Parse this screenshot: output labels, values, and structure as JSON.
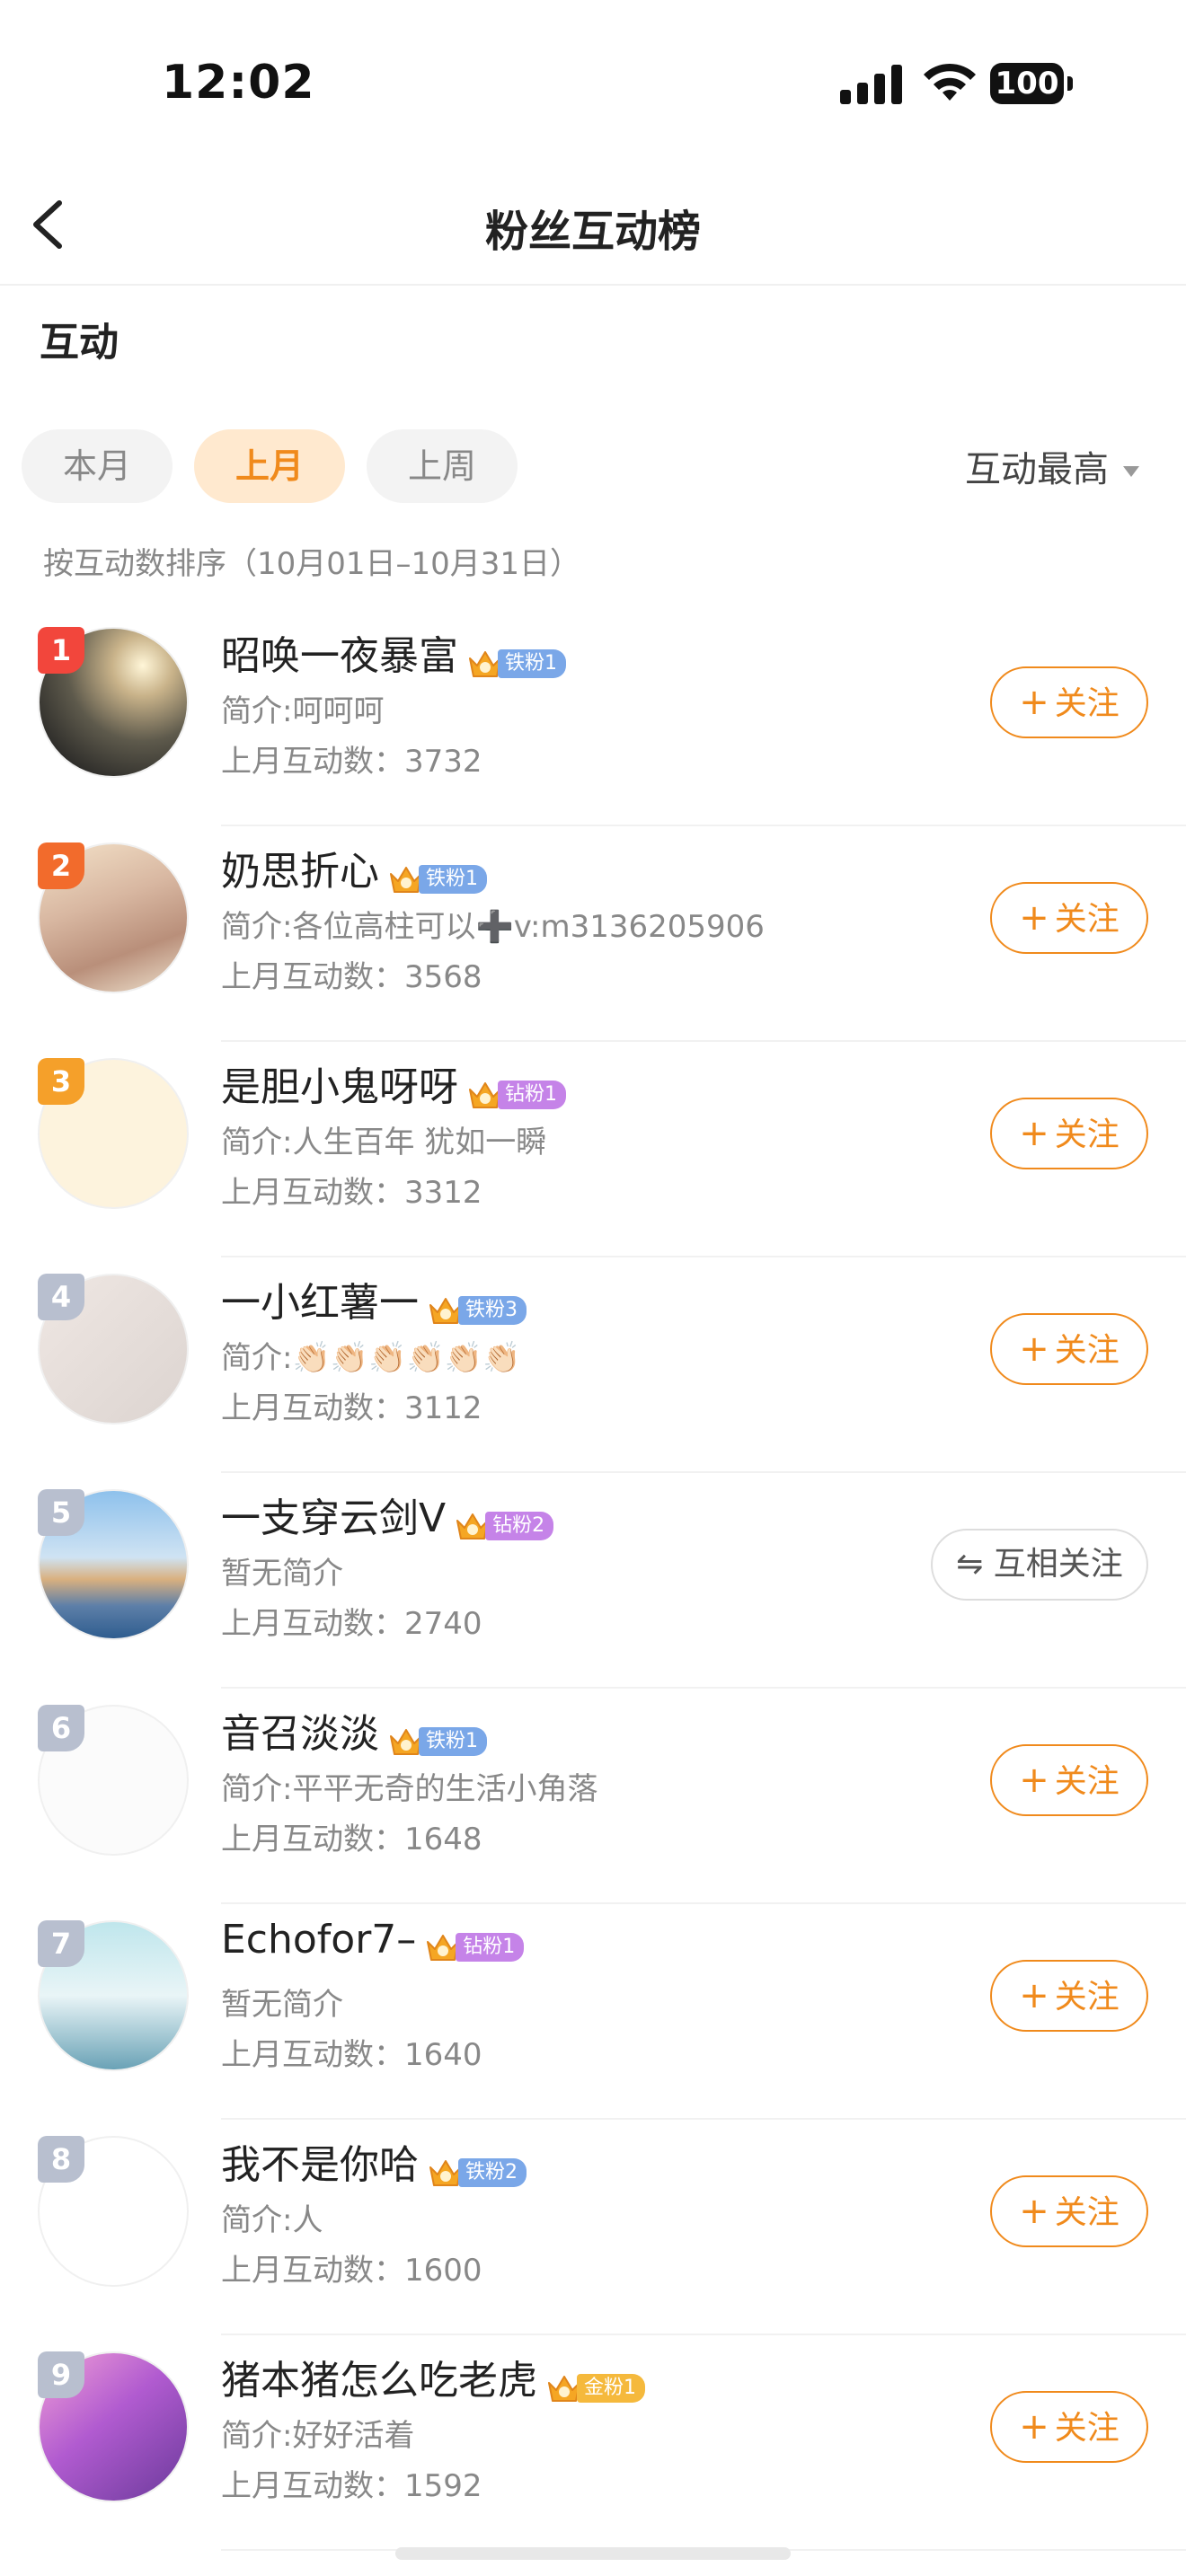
{
  "status": {
    "time": "12:02",
    "battery": "100"
  },
  "nav": {
    "title": "粉丝互动榜",
    "back_icon": "chevron-left-icon"
  },
  "section_title": "互动",
  "tabs": [
    {
      "label": "本月",
      "active": false
    },
    {
      "label": "上月",
      "active": true
    },
    {
      "label": "上周",
      "active": false
    }
  ],
  "sort": {
    "label": "互动最高"
  },
  "range_note": "按互动数排序（10月01日–10月31日）",
  "follow_label": "关注",
  "mutual_label": "互相关注",
  "colors": {
    "accent": "#f08a1c",
    "rank1": "#f2463c",
    "rank2": "#f26b2c",
    "rank3": "#f5a02a",
    "iron_badge": "#7aa7e8",
    "diamond_badge": "#c583e8",
    "gold_badge": "#f5b93c"
  },
  "fans": [
    {
      "rank": "1",
      "name": "昭唤一夜暴富",
      "badge_label": "铁粉1",
      "badge_type": "iron",
      "bio": "简介:呵呵呵",
      "count": "上月互动数：3732",
      "status": "follow"
    },
    {
      "rank": "2",
      "name": "奶思折心",
      "badge_label": "铁粉1",
      "badge_type": "iron",
      "bio": "简介:各位高柱可以➕v:m3136205906",
      "count": "上月互动数：3568",
      "status": "follow"
    },
    {
      "rank": "3",
      "name": "是胆小鬼呀呀",
      "badge_label": "钻粉1",
      "badge_type": "diamond",
      "bio": "简介:人生百年 犹如一瞬",
      "count": "上月互动数：3312",
      "status": "follow"
    },
    {
      "rank": "4",
      "name": "一小红薯一",
      "badge_label": "铁粉3",
      "badge_type": "iron",
      "bio": "简介:👏🏻👏🏻👏🏻👏🏻👏🏻👏🏻",
      "count": "上月互动数：3112",
      "status": "follow"
    },
    {
      "rank": "5",
      "name": "一支穿云剑V",
      "badge_label": "钻粉2",
      "badge_type": "diamond",
      "bio": "暂无简介",
      "count": "上月互动数：2740",
      "status": "mutual"
    },
    {
      "rank": "6",
      "name": "音召淡淡",
      "badge_label": "铁粉1",
      "badge_type": "iron",
      "bio": "简介:平平无奇的生活小角落",
      "count": "上月互动数：1648",
      "status": "follow"
    },
    {
      "rank": "7",
      "name": "Echofor7–",
      "badge_label": "钻粉1",
      "badge_type": "diamond",
      "bio": "暂无简介",
      "count": "上月互动数：1640",
      "status": "follow"
    },
    {
      "rank": "8",
      "name": "我不是你哈",
      "badge_label": "铁粉2",
      "badge_type": "iron",
      "bio": "简介:人",
      "count": "上月互动数：1600",
      "status": "follow"
    },
    {
      "rank": "9",
      "name": "猪本猪怎么吃老虎",
      "badge_label": "金粉1",
      "badge_type": "gold",
      "bio": "简介:好好活着",
      "count": "上月互动数：1592",
      "status": "follow"
    }
  ]
}
